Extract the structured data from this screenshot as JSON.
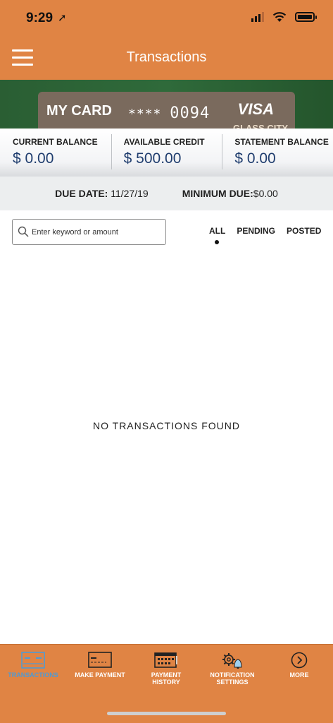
{
  "status": {
    "time": "9:29"
  },
  "header": {
    "title": "Transactions"
  },
  "card": {
    "name": "MY CARD",
    "masked": "****",
    "last4": "0094",
    "network": "VISA",
    "issuer": "GLASS CITY"
  },
  "balances": [
    {
      "label": "CURRENT BALANCE",
      "value": "$ 0.00"
    },
    {
      "label": "AVAILABLE CREDIT",
      "value": "$ 500.00"
    },
    {
      "label": "STATEMENT BALANCE",
      "value": "$ 0.00"
    }
  ],
  "due": {
    "due_label": "DUE DATE:",
    "due_value": "11/27/19",
    "min_label": "MINIMUM DUE:",
    "min_value": "$0.00"
  },
  "search": {
    "placeholder": "Enter keyword or amount"
  },
  "filters": {
    "all": "ALL",
    "pending": "PENDING",
    "posted": "POSTED",
    "selected": "ALL"
  },
  "empty_message": "NO TRANSACTIONS FOUND",
  "bottom_nav": [
    {
      "label": "TRANSACTIONS",
      "icon": "transactions-icon",
      "active": true
    },
    {
      "label": "MAKE PAYMENT",
      "icon": "card-icon",
      "active": false
    },
    {
      "label": "PAYMENT\nHISTORY",
      "icon": "calendar-icon",
      "active": false
    },
    {
      "label": "NOTIFICATION\nSETTINGS",
      "icon": "gear-bell-icon",
      "active": false
    },
    {
      "label": "MORE",
      "icon": "chevron-right-circle-icon",
      "active": false
    }
  ],
  "colors": {
    "brand_orange": "#E08444",
    "active_blue": "#4f9ad3",
    "balance_blue": "#1f3d6e"
  }
}
